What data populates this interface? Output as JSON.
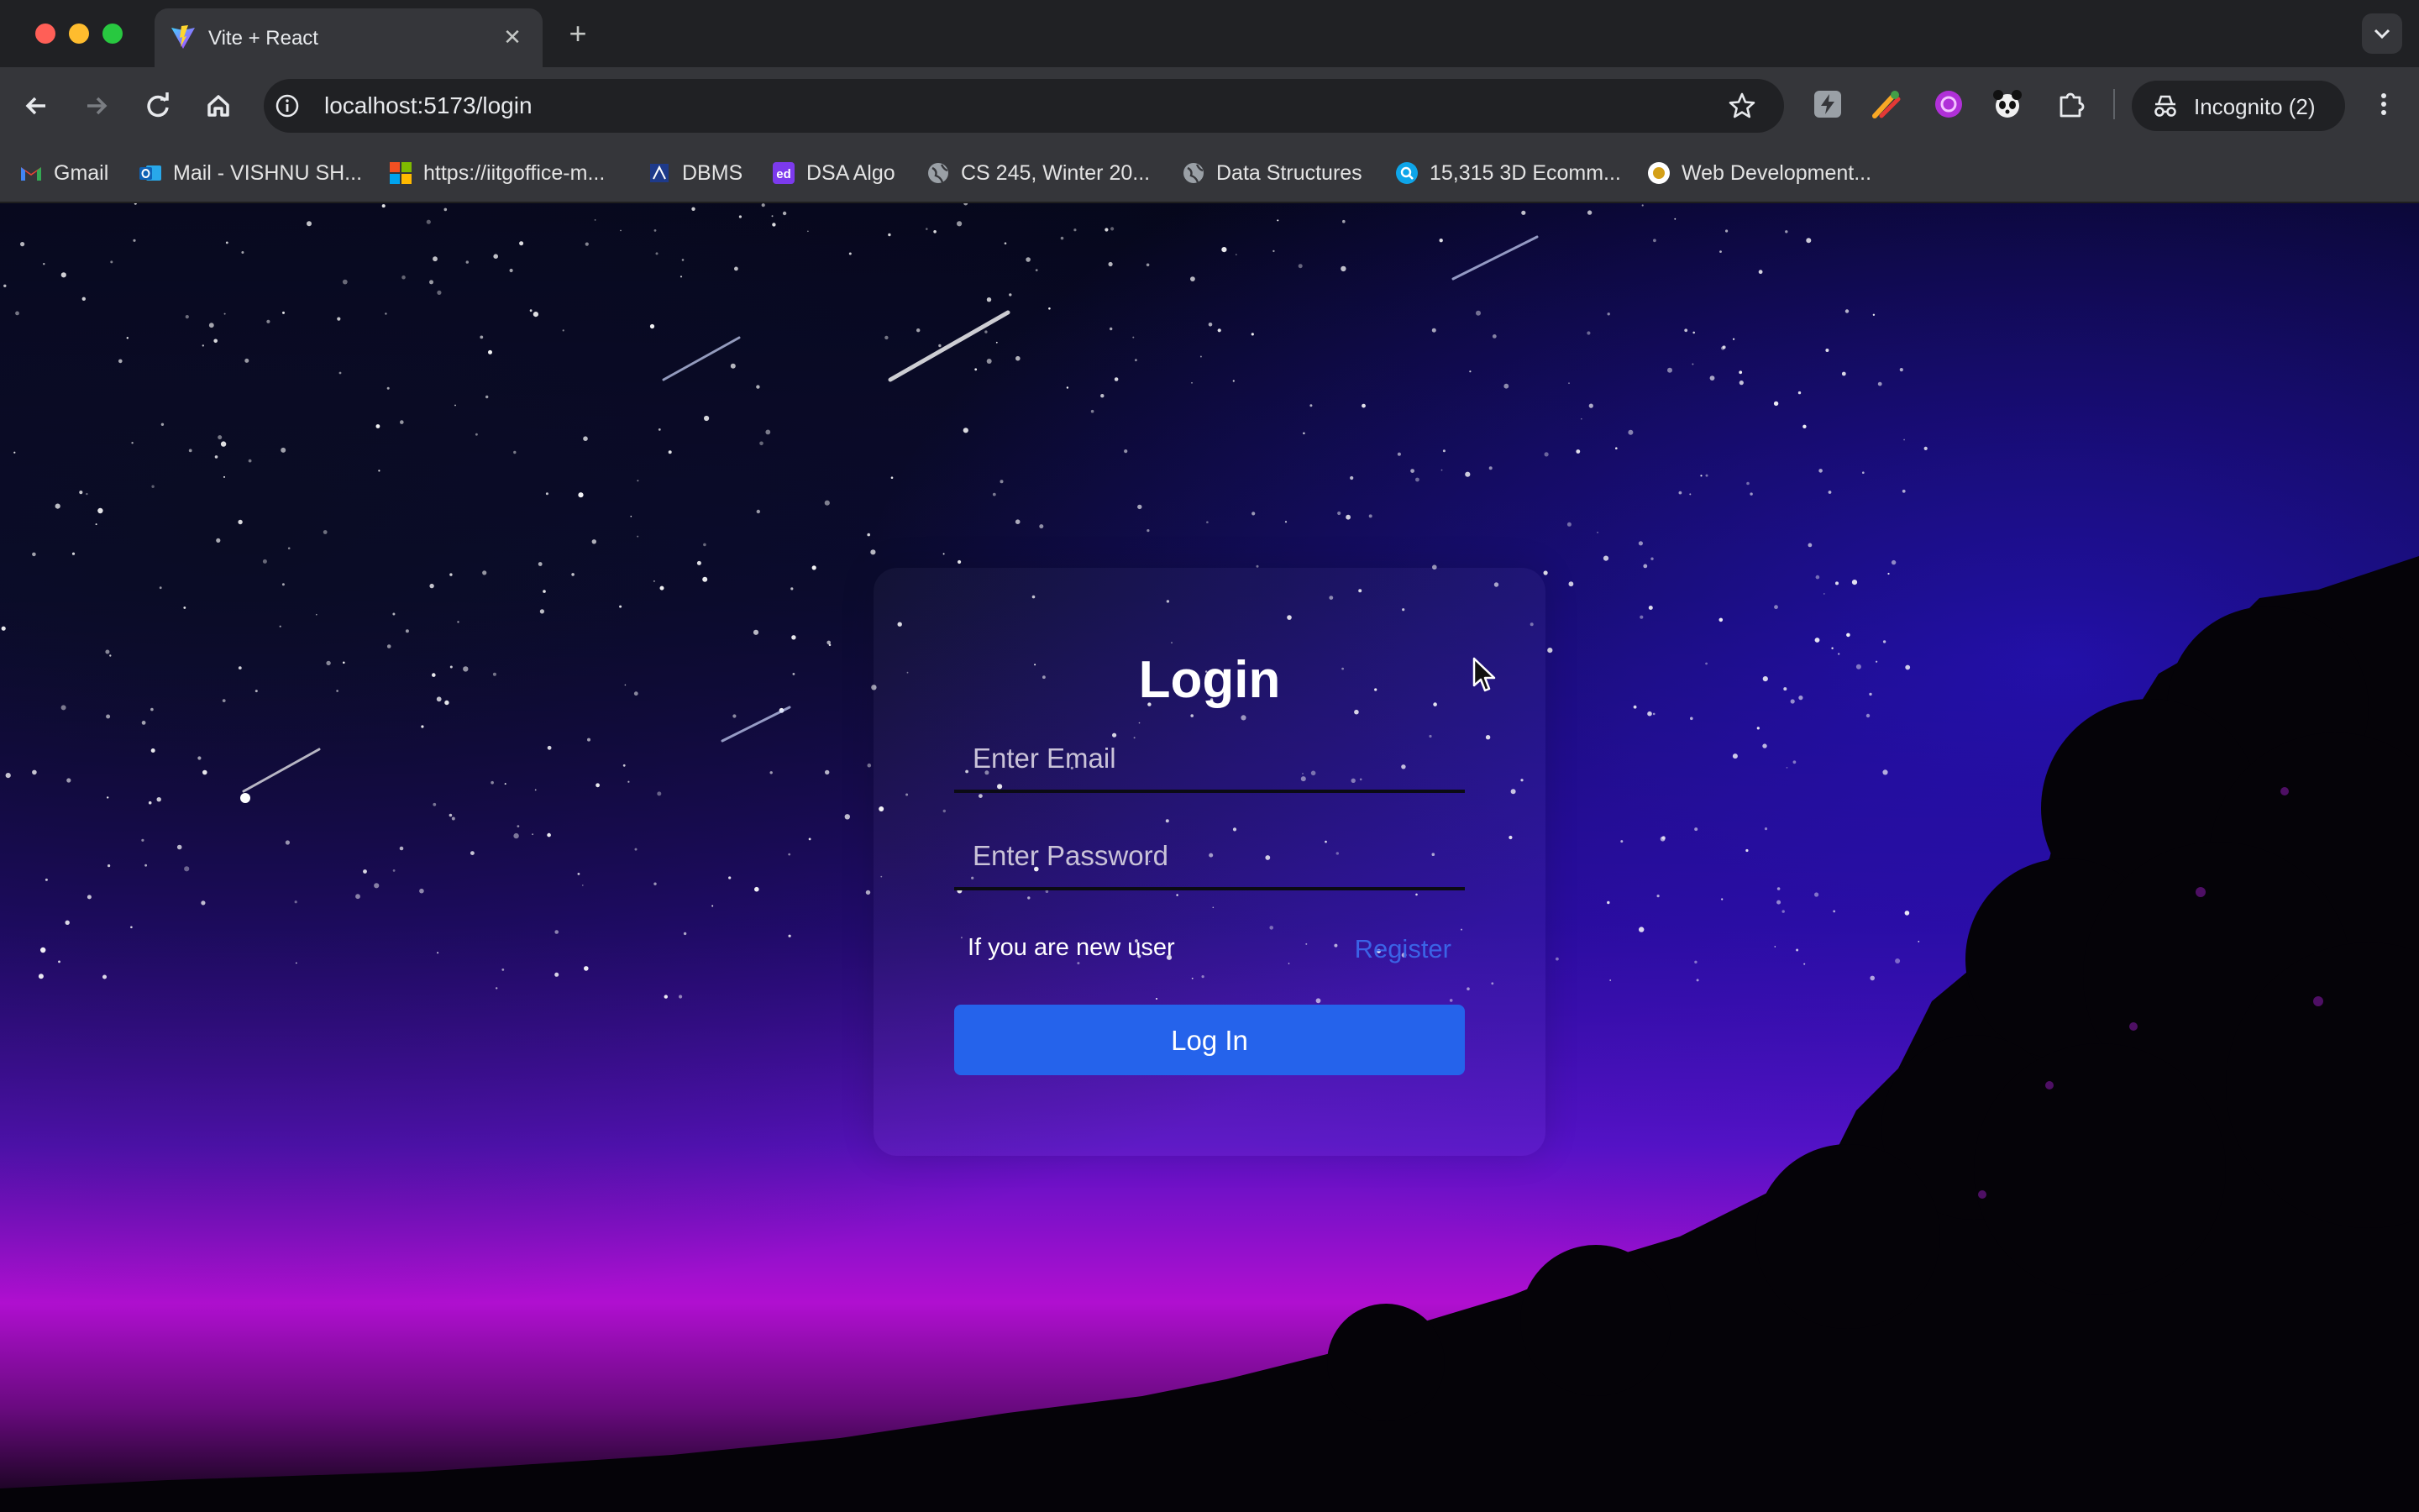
{
  "browser": {
    "tab": {
      "title": "Vite + React",
      "favicon": "vite-icon"
    },
    "url": "localhost:5173/login",
    "incognito_label": "Incognito (2)",
    "bookmarks": [
      {
        "label": "Gmail",
        "icon": "gmail-icon"
      },
      {
        "label": "Mail - VISHNU SH...",
        "icon": "outlook-icon"
      },
      {
        "label": "https://iitgoffice-m...",
        "icon": "microsoft-icon"
      },
      {
        "label": "DBMS",
        "icon": "book-icon"
      },
      {
        "label": "DSA Algo",
        "icon": "ed-icon"
      },
      {
        "label": "CS 245, Winter 20...",
        "icon": "globe-icon"
      },
      {
        "label": "Data Structures",
        "icon": "globe-icon"
      },
      {
        "label": "15,315 3D Ecomm...",
        "icon": "search-badge-icon"
      },
      {
        "label": "Web Development...",
        "icon": "circle-logo-icon"
      }
    ],
    "extensions": [
      "lightning-extension-icon",
      "rocket-extension-icon",
      "purple-extension-icon",
      "panda-extension-icon",
      "puzzle-extensions-icon"
    ]
  },
  "page": {
    "title": "Login",
    "email_placeholder": "Enter Email",
    "password_placeholder": "Enter Password",
    "new_user_text": "If you are new user",
    "register_label": "Register",
    "login_button": "Log In"
  },
  "colors": {
    "primary_button": "#2563eb",
    "register_link": "#3b63e6",
    "sky_top": "#06081a",
    "sky_horizon": "#c90fd6"
  }
}
